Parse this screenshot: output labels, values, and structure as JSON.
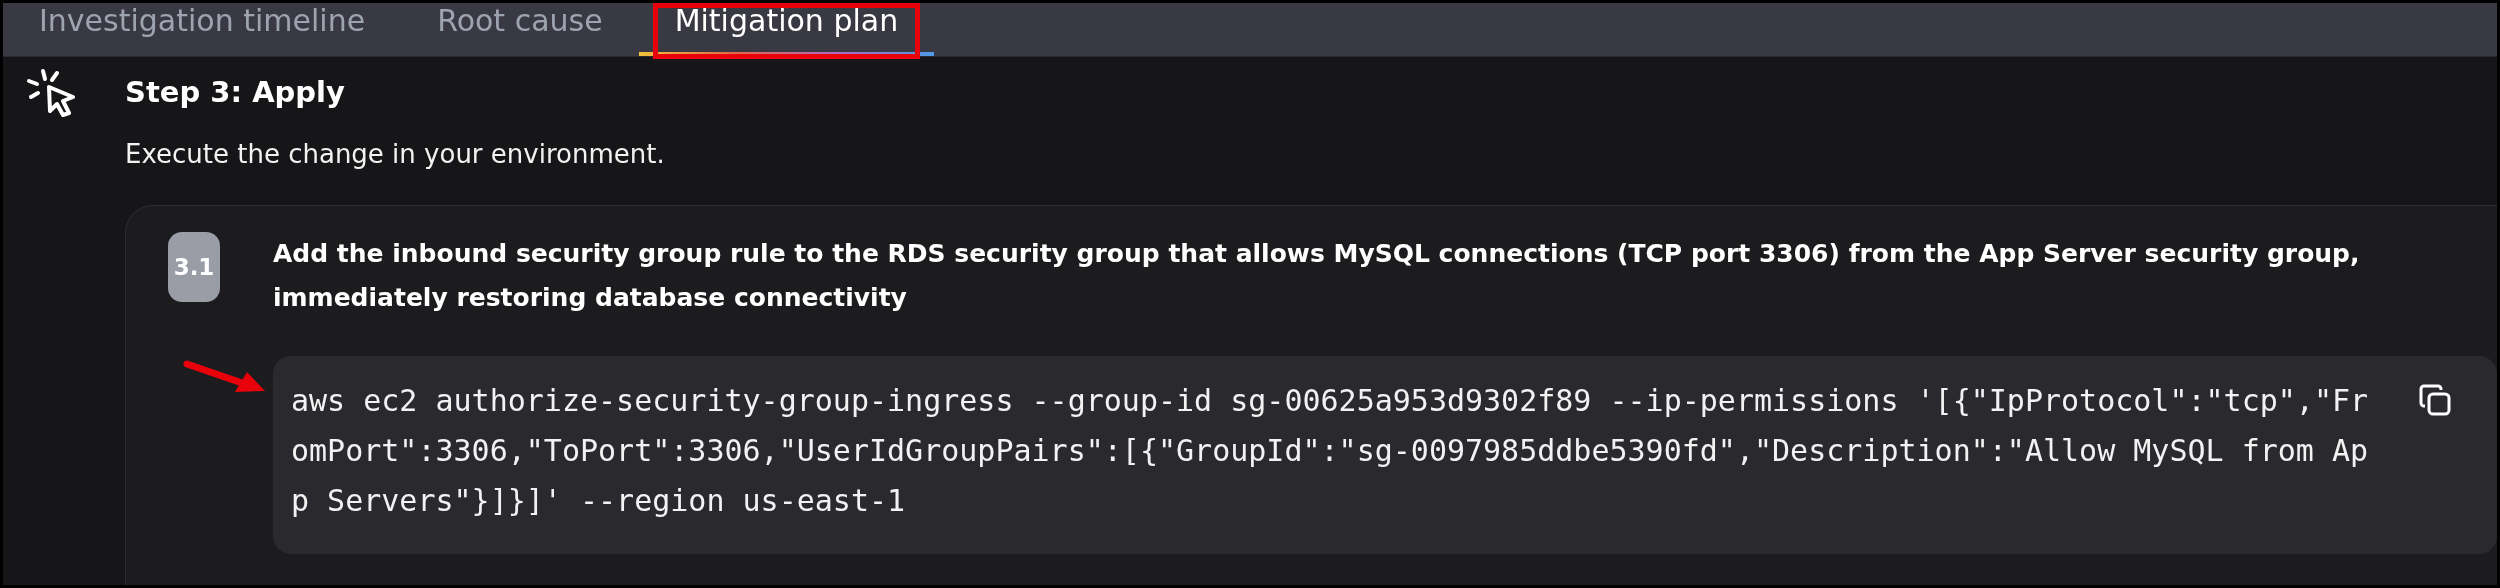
{
  "tabs": [
    {
      "label": "Investigation timeline",
      "selected": false,
      "highlighted": false
    },
    {
      "label": "Root cause",
      "selected": false,
      "highlighted": false
    },
    {
      "label": "Mitigation plan",
      "selected": true,
      "highlighted": true
    }
  ],
  "step": {
    "title": "Step 3: Apply",
    "description": "Execute the change in your environment.",
    "substeps": [
      {
        "number": "3.1",
        "title": "Add the inbound security group rule to the RDS security group that allows MySQL connections (TCP port 3306) from the App Server security group, immediately restoring database connectivity",
        "code": "aws ec2 authorize-security-group-ingress --group-id sg-00625a953d9302f89 --ip-permissions '[{\"IpProtocol\":\"tcp\",\"FromPort\":3306,\"ToPort\":3306,\"UserIdGroupPairs\":[{\"GroupId\":\"sg-0097985ddbe5390fd\",\"Description\":\"Allow MySQL from App Servers\"}]}]' --region us-east-1",
        "pointed": true
      }
    ]
  }
}
